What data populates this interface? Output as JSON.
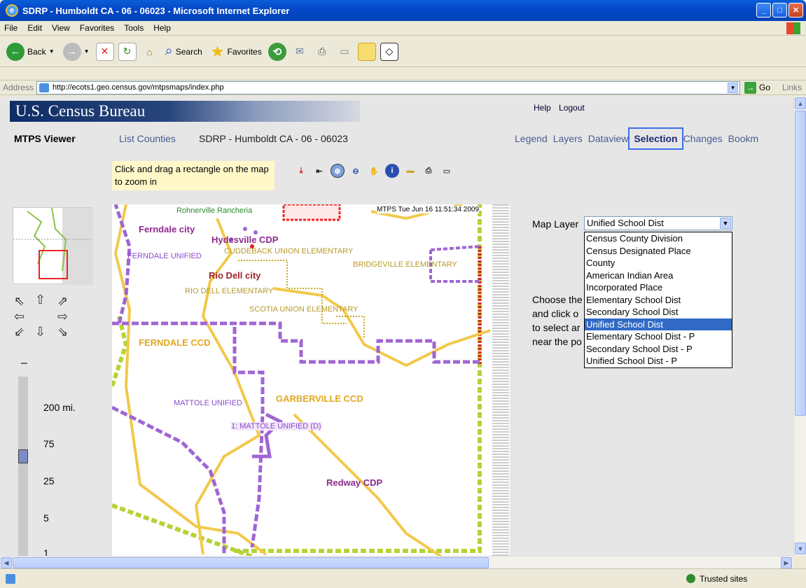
{
  "window": {
    "title": "SDRP - Humboldt CA - 06 - 06023 - Microsoft Internet Explorer"
  },
  "menu": [
    "File",
    "Edit",
    "View",
    "Favorites",
    "Tools",
    "Help"
  ],
  "toolbar": {
    "back": "Back",
    "search": "Search",
    "favorites": "Favorites"
  },
  "address": {
    "label": "Address",
    "url": "http://ecots1.geo.census.gov/mtpsmaps/index.php",
    "go": "Go",
    "links": "Links"
  },
  "header": {
    "banner": "U.S. Census Bureau",
    "help": "Help",
    "logout": "Logout"
  },
  "nav": {
    "viewer": "MTPS Viewer",
    "list_counties": "List Counties",
    "current": "SDRP - Humboldt CA - 06 - 06023",
    "tabs": [
      "Legend",
      "Layers",
      "Dataview",
      "Selection",
      "Changes",
      "Bookm"
    ]
  },
  "hint": "Click and drag a rectangle on the map to zoom in",
  "map": {
    "timestamp": "MTPS Tue Jun 16 11:51:34 2009",
    "labels": {
      "rohnerville": "Rohnerville Rancheria",
      "ferndale_city": "Ferndale city",
      "hydesville": "Hydesville CDP",
      "cuddeback": "CUDDEBACK UNION ELEMENTARY",
      "ferndale_unified": "FERNDALE UNIFIED",
      "bridgeville": "BRIDGEVILLE ELEMENTARY",
      "rio_dell_city": "Rio Dell city",
      "rio_dell_elem": "RIO DELL ELEMENTARY",
      "scotia": "SCOTIA UNION ELEMENTARY",
      "ferndale_ccd": "FERNDALE CCD",
      "mattole": "MATTOLE UNIFIED",
      "garberville": "GARBERVILLE CCD",
      "selected": "1: MATTOLE UNIFIED (D)",
      "redway": "Redway CDP"
    }
  },
  "scale": [
    "200 mi.",
    "75",
    "25",
    "5",
    "1"
  ],
  "layer_panel": {
    "label": "Map Layer",
    "selected": "Unified School Dist",
    "options": [
      "Census County Division",
      "Census Designated Place",
      "County",
      "American Indian Area",
      "Incorporated Place",
      "Elementary School Dist",
      "Secondary School Dist",
      "Unified School Dist",
      "Elementary School Dist - P",
      "Secondary School Dist - P",
      "Unified School Dist - P"
    ],
    "choose_lines": [
      "Choose the",
      "and click o",
      "to select ar",
      "near the po"
    ]
  },
  "status": {
    "zone": "Trusted sites"
  },
  "colors": {
    "highlight": "#316ac5",
    "tab_outline": "#3a6fe8",
    "boundary_purple": "#9b59c9",
    "road_yellow": "#f2c94c"
  }
}
